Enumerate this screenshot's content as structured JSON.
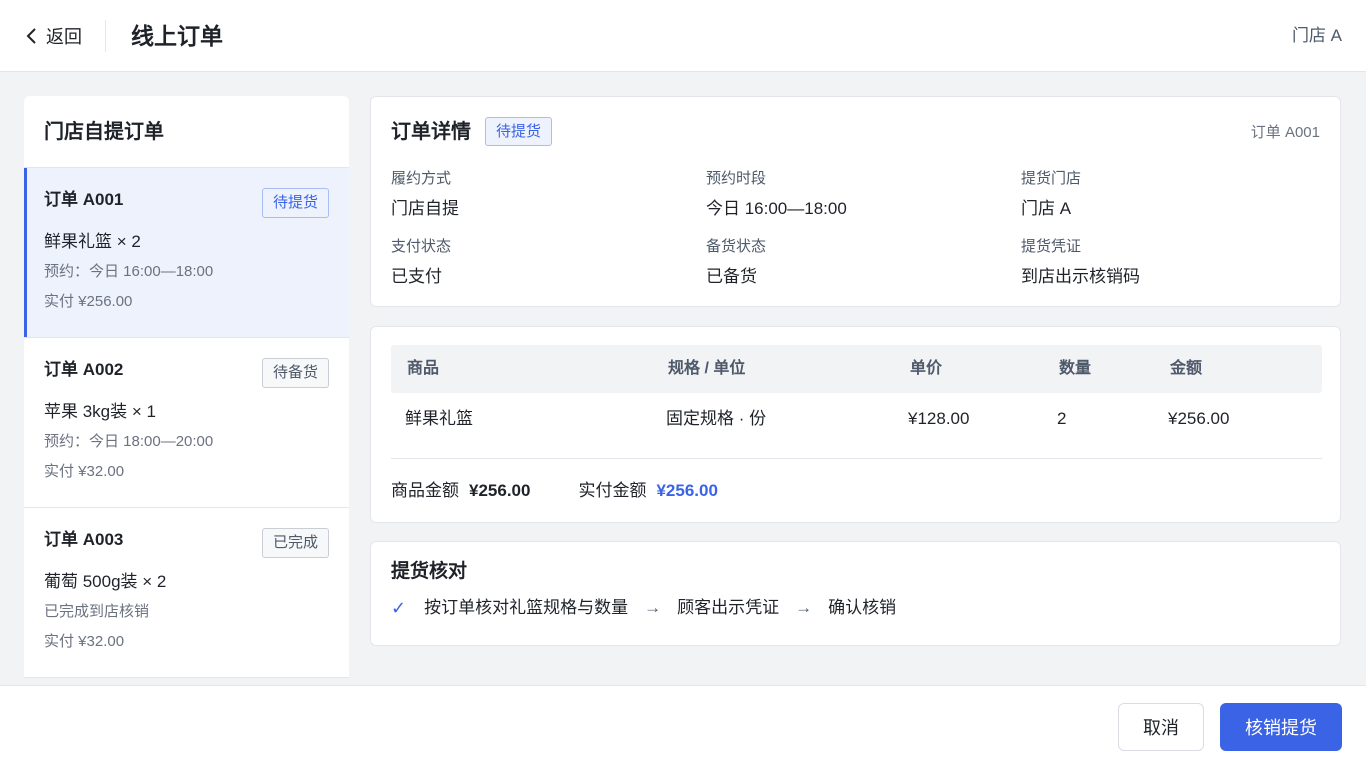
{
  "header": {
    "back_label": "返回",
    "title": "线上订单",
    "store": "门店 A"
  },
  "left": {
    "title": "门店自提订单",
    "orders": [
      {
        "id": "订单 A001",
        "status": "待提货",
        "goods": "鲜果礼篮 × 2",
        "sub": "预约：今日 16:00—18:00",
        "paid": "实付 ¥256.00"
      },
      {
        "id": "订单 A002",
        "status": "待备货",
        "goods": "苹果 3kg装 × 1",
        "sub": "预约：今日 18:00—20:00",
        "paid": "实付 ¥32.00"
      },
      {
        "id": "订单 A003",
        "status": "已完成",
        "goods": "葡萄 500g装 × 2",
        "sub": "已完成到店核销",
        "paid": "实付 ¥32.00"
      }
    ]
  },
  "detail": {
    "title": "订单详情",
    "status": "待提货",
    "order_no": "订单 A001",
    "fields": [
      {
        "label": "履约方式",
        "value": "门店自提"
      },
      {
        "label": "预约时段",
        "value": "今日 16:00—18:00"
      },
      {
        "label": "提货门店",
        "value": "门店 A"
      },
      {
        "label": "支付状态",
        "value": "已支付"
      },
      {
        "label": "备货状态",
        "value": "已备货"
      },
      {
        "label": "提货凭证",
        "value": "到店出示核销码"
      }
    ]
  },
  "goods": {
    "headers": [
      "商品",
      "规格 / 单位",
      "单价",
      "数量",
      "金额"
    ],
    "rows": [
      [
        "鲜果礼篮",
        "固定规格 · 份",
        "¥128.00",
        "2",
        "¥256.00"
      ]
    ],
    "subtotal_label": "商品金额",
    "subtotal": "¥256.00",
    "paid_label": "实付金额",
    "paid": "¥256.00"
  },
  "verify": {
    "title": "提货核对",
    "check": "✓",
    "steps": [
      "按订单核对礼篮规格与数量",
      "顾客出示凭证",
      "确认核销"
    ],
    "arrow": "→"
  },
  "footer": {
    "cancel_label": "取消",
    "confirm_label": "核销提货"
  },
  "colors": {
    "accent": "#3b63e6",
    "active_bg": "#eef2fd"
  }
}
